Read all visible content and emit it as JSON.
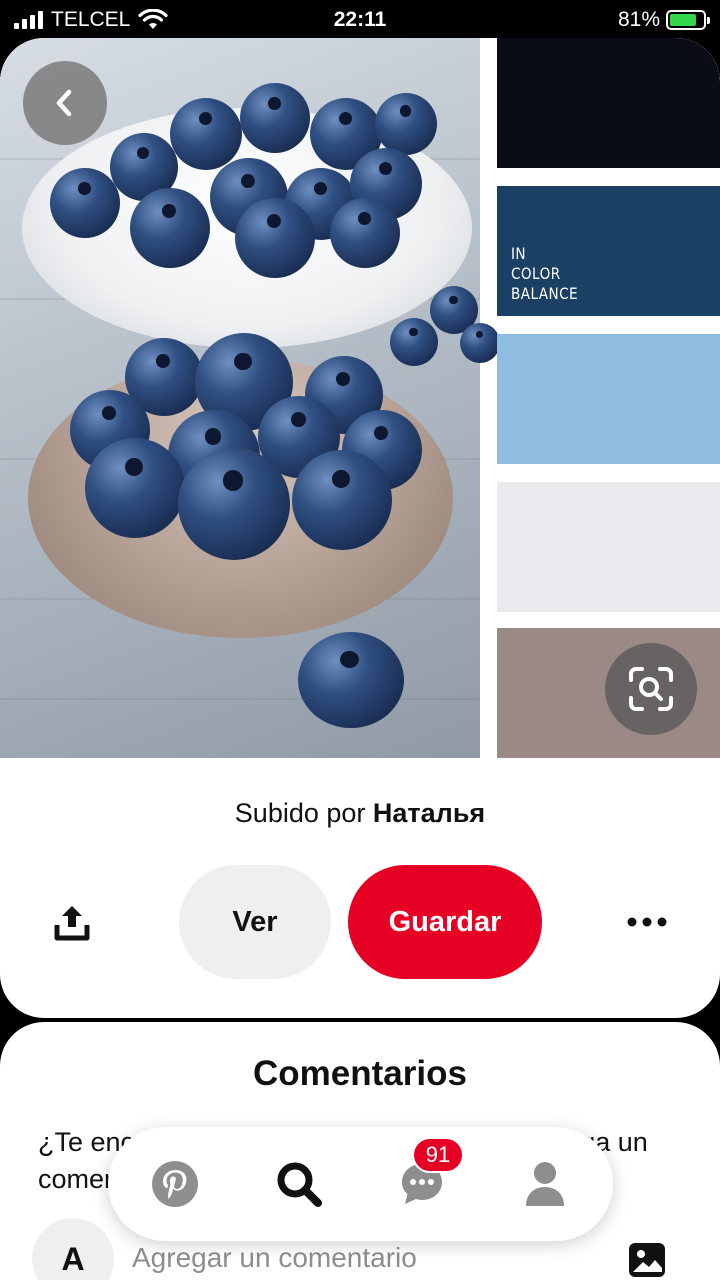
{
  "status_bar": {
    "carrier": "TELCEL",
    "time": "22:11",
    "battery_percent": "81%",
    "battery_level": 0.81
  },
  "pin": {
    "brand_lines": [
      "IN",
      "COLOR",
      "BALANCE"
    ],
    "palette_colors": [
      "#0b0d16",
      "#1a4064",
      "#8fbce1",
      "#e9e9ee",
      "#9a8984"
    ],
    "uploaded_prefix": "Subido por",
    "uploaded_by": "Наталья"
  },
  "actions": {
    "view_label": "Ver",
    "save_label": "Guardar"
  },
  "comments": {
    "title": "Comentarios",
    "prompt": "¿Te encanta este Pin? Dile a Наталья o agrega un comentario",
    "avatar_initial": "A",
    "placeholder": "Agregar un comentario"
  },
  "nav": {
    "items": [
      "home-icon",
      "search-icon",
      "messages-icon",
      "profile-icon"
    ],
    "messages_badge": "91"
  },
  "colors": {
    "brand_red": "#e60023",
    "button_gray": "#efefef"
  }
}
